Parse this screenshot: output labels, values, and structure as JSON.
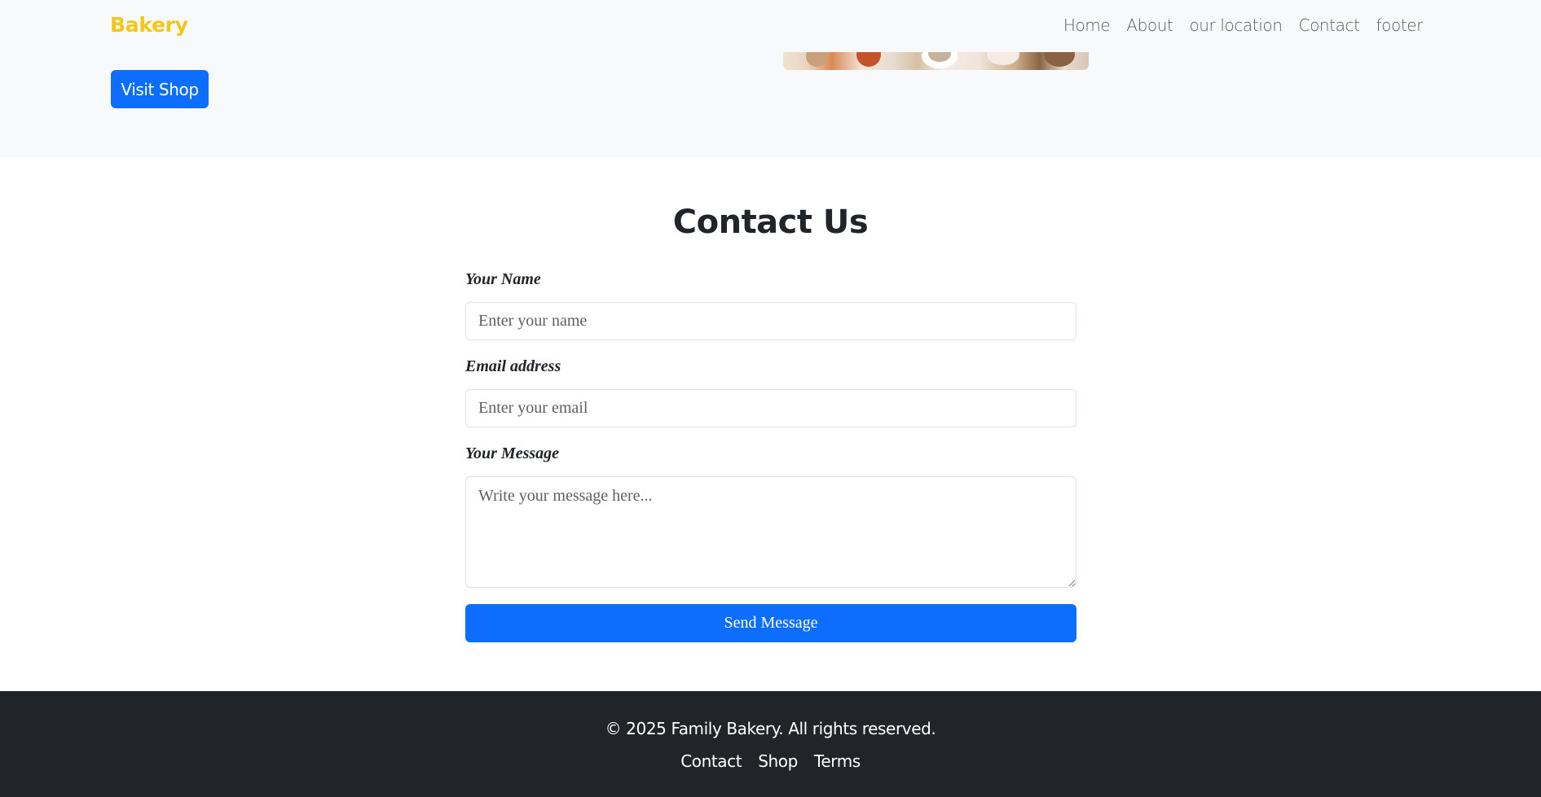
{
  "navbar": {
    "brand": "Bakery",
    "brand_color": "#f5c518",
    "links": [
      "Home",
      "About",
      "our location",
      "Contact",
      "footer"
    ]
  },
  "hero": {
    "visit_shop_label": "Visit Shop"
  },
  "contact": {
    "title": "Contact Us",
    "name_label": "Your Name",
    "name_placeholder": "Enter your name",
    "email_label": "Email address",
    "email_placeholder": "Enter your email",
    "message_label": "Your Message",
    "message_placeholder": "Write your message here...",
    "send_label": "Send Message"
  },
  "footer": {
    "copyright": "© 2025 Family Bakery. All rights reserved.",
    "links": [
      "Contact",
      "Shop",
      "Terms"
    ]
  },
  "colors": {
    "primary": "#0d6efd",
    "footer_bg": "#212529",
    "hero_bg": "#f8f9fa"
  }
}
